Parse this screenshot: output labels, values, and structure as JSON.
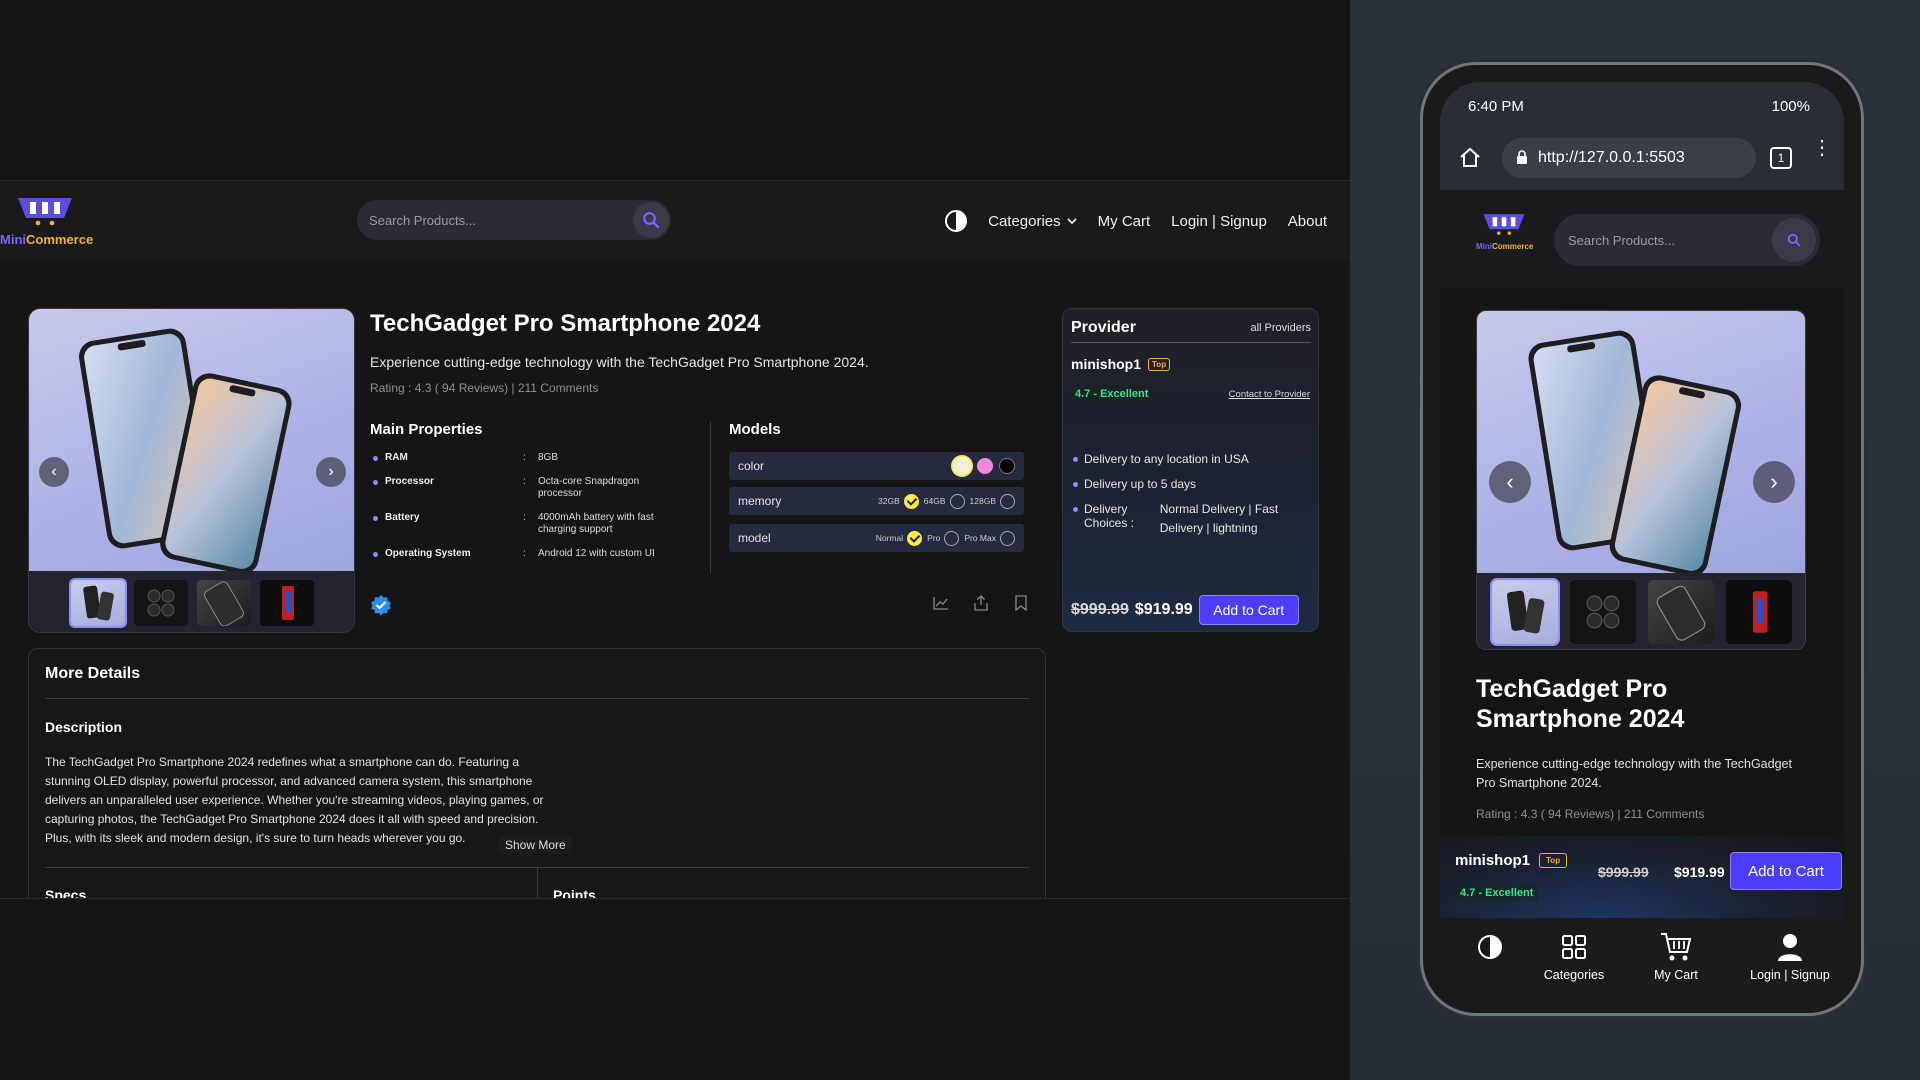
{
  "brand": {
    "part1": "Mini",
    "part2": "Commerce"
  },
  "search": {
    "placeholder": "Search Products..."
  },
  "nav": {
    "categories": "Categories",
    "cart": "My Cart",
    "login": "Login | Signup",
    "about": "About"
  },
  "product": {
    "title": "TechGadget Pro Smartphone 2024",
    "short_desc": "Experience cutting-edge technology with the TechGadget Pro Smartphone 2024.",
    "rating_line": "Rating : 4.3 ( 94 Reviews) | 211 Comments"
  },
  "main_properties": {
    "title": "Main Properties",
    "items": [
      {
        "key": "RAM",
        "value": "8GB"
      },
      {
        "key": "Processor",
        "value": "Octa-core Snapdragon processor"
      },
      {
        "key": "Battery",
        "value": "4000mAh battery with fast charging support"
      },
      {
        "key": "Operating System",
        "value": "Android 12 with custom UI"
      }
    ]
  },
  "models": {
    "title": "Models",
    "color": {
      "label": "color",
      "swatches": [
        "#f4f0d6",
        "#f08ad8",
        "#050505"
      ],
      "selected": 0
    },
    "memory": {
      "label": "memory",
      "options": [
        "32GB",
        "64GB",
        "128GB"
      ],
      "selected": 0
    },
    "model": {
      "label": "model",
      "options": [
        "Normal",
        "Pro",
        "Pro Max"
      ],
      "selected": 0
    }
  },
  "provider": {
    "title": "Provider",
    "all_link": "all Providers",
    "shop": "minishop1",
    "badge": "Top",
    "score": "4.7 - Excellent",
    "contact": "Contact to Provider",
    "delivery": [
      "Delivery to any location in USA",
      "Delivery up to 5 days"
    ],
    "choices_label": "Delivery Choices :",
    "choices_value": "Normal Delivery | Fast Delivery | lightning",
    "old_price": "$999.99",
    "new_price": "$919.99",
    "add_to_cart": "Add to Cart"
  },
  "details": {
    "title": "More Details",
    "desc_title": "Description",
    "desc_text": "The TechGadget Pro Smartphone 2024 redefines what a smartphone can do. Featuring a stunning OLED display, powerful processor, and advanced camera system, this smartphone delivers an unparalleled user experience. Whether you're streaming videos, playing games, or capturing photos, the TechGadget Pro Smartphone 2024 does it all with speed and precision. Plus, with its sleek and modern design, it's sure to turn heads wherever you go.",
    "show_more": "Show More",
    "specs": "Specs",
    "points": "Points"
  },
  "mobile": {
    "time": "6:40 PM",
    "battery": "100%",
    "url": "http://127.0.0.1:5503",
    "tabs_count": "1",
    "title": "TechGadget Pro Smartphone 2024",
    "tab_categories": "Categories",
    "tab_cart": "My Cart",
    "tab_login": "Login | Signup"
  },
  "colors": {
    "accent": "#4b3dfb",
    "brand_purple": "#7b61ff",
    "brand_orange": "#f2b134",
    "success": "#3fe08a"
  }
}
